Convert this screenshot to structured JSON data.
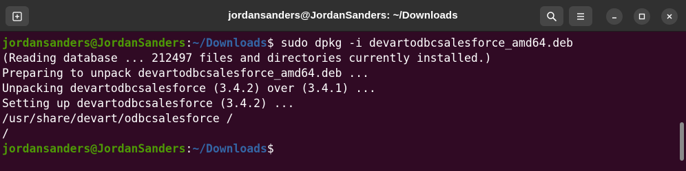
{
  "window": {
    "title": "jordansanders@JordanSanders: ~/Downloads"
  },
  "titlebar": {
    "new_tab_icon": "new-tab-icon",
    "search_icon": "search-icon",
    "menu_icon": "hamburger-menu-icon",
    "minimize_icon": "minimize-icon",
    "maximize_icon": "maximize-icon",
    "close_icon": "close-icon"
  },
  "colors": {
    "background": "#300a24",
    "prompt_user": "#4e9a06",
    "prompt_path": "#3465a4",
    "text": "#ffffff"
  },
  "terminal": {
    "prompt": {
      "user_host": "jordansanders@JordanSanders",
      "colon": ":",
      "path": "~/Downloads",
      "symbol": "$"
    },
    "command": " sudo dpkg -i devartodbcsalesforce_amd64.deb",
    "output": [
      "(Reading database ... 212497 files and directories currently installed.)",
      "Preparing to unpack devartodbcsalesforce_amd64.deb ...",
      "Unpacking devartodbcsalesforce (3.4.2) over (3.4.1) ...",
      "Setting up devartodbcsalesforce (3.4.2) ...",
      "/usr/share/devart/odbcsalesforce /",
      "/"
    ]
  }
}
